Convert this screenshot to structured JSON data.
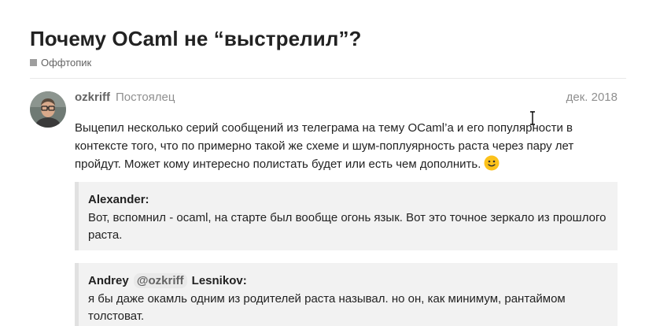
{
  "topic": {
    "title": "Почему OCaml не “выстрелил”?",
    "category": "Оффтопик"
  },
  "post": {
    "username": "ozkriff",
    "user_title": "Постоялец",
    "date": "дек. 2018",
    "body": "Выцепил несколько серий сообщений из телеграма на тему OCaml’а и его популярности в контексте того, что по примерно такой же схеме и шум-поплуярность раста через пару лет пройдут. Может кому интересно полистать будет или есть чем дополнить.",
    "emoji": "slight-smile"
  },
  "quotes": [
    {
      "author": "Alexander:",
      "text": "Вот, вспомнил - ocaml, на старте был вообще огонь язык. Вот это точное зеркало из прошлого раста."
    },
    {
      "author_first": "Andrey",
      "mention": "@ozkriff",
      "author_last": "Lesnikov:",
      "text": "я бы даже окамль одним из родителей раста называл. но он, как минимум, рантаймом толстоват."
    }
  ],
  "colors": {
    "text": "#222222",
    "muted": "#8f8f8f",
    "quote_bg": "#f2f2f2",
    "quote_border": "#e1e1e1",
    "category_swatch": "#9e9e9e"
  }
}
